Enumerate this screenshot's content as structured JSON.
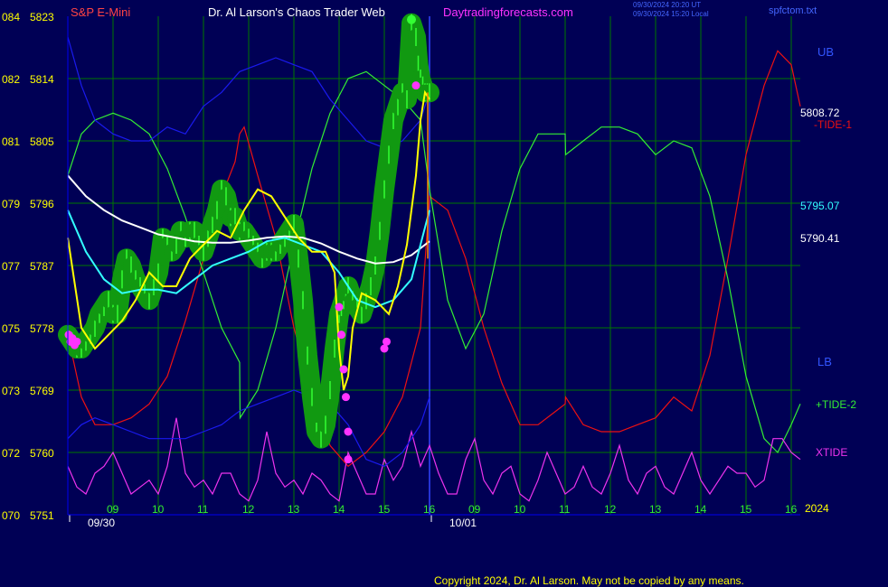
{
  "header": {
    "symbol": "S&P E-Mini",
    "author": "Dr. Al Larson's Chaos Trader Web",
    "site": "Daytradingforecasts.com",
    "stamp1": "09/30/2024 20:20 UT",
    "stamp2": "09/30/2024 15:20 Local",
    "file": "spfctom.txt"
  },
  "footer": {
    "copyright": "Copyright 2024, Dr. Al Larson. May not be copied by any means."
  },
  "chart_data": {
    "type": "line",
    "title": "S&P E-Mini",
    "ylim": [
      5751,
      5823
    ],
    "y_ticks": [
      {
        "outer": "084",
        "price": "5823",
        "v": 5823
      },
      {
        "outer": "082",
        "price": "5814",
        "v": 5814
      },
      {
        "outer": "081",
        "price": "5805",
        "v": 5805
      },
      {
        "outer": "079",
        "price": "5796",
        "v": 5796
      },
      {
        "outer": "077",
        "price": "5787",
        "v": 5787
      },
      {
        "outer": "075",
        "price": "5778",
        "v": 5778
      },
      {
        "outer": "073",
        "price": "5769",
        "v": 5769
      },
      {
        "outer": "072",
        "price": "5760",
        "v": 5760
      },
      {
        "outer": "070",
        "price": "5751",
        "v": 5751
      }
    ],
    "x_hour_ticks": [
      "09",
      "10",
      "11",
      "12",
      "13",
      "14",
      "15",
      "16",
      "09",
      "10",
      "11",
      "12",
      "13",
      "14",
      "15",
      "16"
    ],
    "x_hour_pos": [
      1.0,
      2.0,
      3.0,
      4.0,
      5.0,
      6.0,
      7.0,
      8.0,
      9.0,
      10.0,
      11.0,
      12.0,
      13.0,
      14.0,
      15.0,
      16.0
    ],
    "x_dates": [
      {
        "label": "09/30",
        "x": 0.8
      },
      {
        "label": "10/01",
        "x": 8.8
      }
    ],
    "x_corner": "2024",
    "xlim": [
      0,
      16.2
    ],
    "now_x": 8.0,
    "right_labels": {
      "ub": "UB",
      "lb": "LB",
      "value1": "5808.72",
      "value2": "5795.07",
      "value3": "5790.41",
      "tide1": "-TIDE-1",
      "tide2": "+TIDE-2",
      "xtide": "XTIDE"
    },
    "colors": {
      "background": "#000055",
      "grid": "#007700",
      "price_bar": "#33ff33",
      "glow": "#119911",
      "fast_ma": "#ffff00",
      "ma_cyan": "#33ffff",
      "ma_white": "#ffffff",
      "tide1": "#ee1111",
      "tide2": "#33ee33",
      "xtide": "#ee33ee",
      "bands": "#0000ee",
      "marker": "#ff33ff"
    },
    "series": [
      {
        "name": "-TIDE-1",
        "color": "#ee1111",
        "x": [
          0,
          0.3,
          0.6,
          1.0,
          1.4,
          1.8,
          2.2,
          2.6,
          3.0,
          3.4,
          3.7,
          3.8,
          3.9,
          4.2,
          4.6,
          5.0,
          5.4,
          5.8,
          6.2,
          6.6,
          7.0,
          7.4,
          7.8,
          8.0,
          8.4,
          8.8,
          9.2,
          9.6,
          10.0,
          10.4,
          10.8,
          11.0,
          11.01,
          11.4,
          11.8,
          12.2,
          12.6,
          13.0,
          13.4,
          13.8,
          14.2,
          14.6,
          15.0,
          15.4,
          15.7,
          16.0,
          16.2
        ],
        "y": [
          5777,
          5768,
          5764,
          5764,
          5765,
          5767,
          5771,
          5779,
          5788,
          5797,
          5802,
          5806,
          5807,
          5800,
          5791,
          5778,
          5769,
          5761,
          5758,
          5760,
          5763,
          5768,
          5778,
          5797,
          5795,
          5788,
          5778,
          5770,
          5764,
          5764,
          5766,
          5767,
          5768,
          5764,
          5763,
          5763,
          5764,
          5765,
          5768,
          5766,
          5774,
          5788,
          5803,
          5813,
          5818,
          5816,
          5810
        ]
      },
      {
        "name": "+TIDE-2",
        "color": "#33ee33",
        "x": [
          0,
          0.3,
          0.6,
          1.0,
          1.4,
          1.8,
          2.2,
          2.6,
          3.0,
          3.4,
          3.8,
          3.81,
          4.2,
          4.6,
          5.0,
          5.4,
          5.8,
          6.2,
          6.6,
          7.0,
          7.4,
          7.8,
          8.0,
          8.4,
          8.8,
          9.2,
          9.6,
          10.0,
          10.4,
          10.8,
          11.0,
          11.01,
          11.4,
          11.8,
          12.2,
          12.6,
          13.0,
          13.4,
          13.8,
          14.2,
          14.6,
          15.0,
          15.4,
          15.7,
          16.0,
          16.2
        ],
        "y": [
          5800,
          5806,
          5808,
          5809,
          5808,
          5806,
          5801,
          5794,
          5786,
          5778,
          5773,
          5765,
          5769,
          5778,
          5790,
          5801,
          5809,
          5814,
          5815,
          5813,
          5811,
          5808,
          5798,
          5782,
          5775,
          5780,
          5792,
          5801,
          5806,
          5806,
          5806,
          5803,
          5805,
          5807,
          5807,
          5806,
          5803,
          5805,
          5804,
          5797,
          5785,
          5771,
          5762,
          5760,
          5764,
          5767
        ]
      },
      {
        "name": "XTIDE",
        "color": "#ee33ee",
        "x": [
          0,
          0.2,
          0.4,
          0.6,
          0.8,
          1.0,
          1.2,
          1.4,
          1.6,
          1.8,
          2.0,
          2.2,
          2.4,
          2.6,
          2.8,
          3.0,
          3.2,
          3.4,
          3.6,
          3.8,
          4.0,
          4.2,
          4.4,
          4.6,
          4.8,
          5.0,
          5.2,
          5.4,
          5.6,
          5.8,
          6.0,
          6.2,
          6.4,
          6.6,
          6.8,
          7.0,
          7.2,
          7.4,
          7.6,
          7.8,
          8.0,
          8.2,
          8.4,
          8.6,
          8.8,
          9.0,
          9.2,
          9.4,
          9.6,
          9.8,
          10.0,
          10.2,
          10.4,
          10.6,
          10.8,
          11.0,
          11.2,
          11.4,
          11.6,
          11.8,
          12.0,
          12.2,
          12.4,
          12.6,
          12.8,
          13.0,
          13.2,
          13.4,
          13.6,
          13.8,
          14.0,
          14.2,
          14.4,
          14.6,
          14.8,
          15.0,
          15.2,
          15.4,
          15.6,
          15.8,
          16.0,
          16.2
        ],
        "y": [
          5758,
          5755,
          5754,
          5757,
          5758,
          5760,
          5757,
          5754,
          5755,
          5756,
          5754,
          5758,
          5765,
          5757,
          5755,
          5756,
          5754,
          5757,
          5757,
          5754,
          5753,
          5756,
          5763,
          5757,
          5755,
          5756,
          5754,
          5757,
          5756,
          5754,
          5753,
          5760,
          5757,
          5754,
          5754,
          5759,
          5756,
          5758,
          5763,
          5758,
          5761,
          5757,
          5754,
          5754,
          5759,
          5762,
          5756,
          5754,
          5757,
          5758,
          5754,
          5753,
          5756,
          5760,
          5757,
          5754,
          5755,
          5758,
          5755,
          5754,
          5757,
          5761,
          5756,
          5754,
          5757,
          5758,
          5755,
          5754,
          5757,
          5760,
          5756,
          5754,
          5756,
          5758,
          5757,
          5757,
          5755,
          5756,
          5762,
          5762,
          5760,
          5759
        ]
      },
      {
        "name": "upper band",
        "color": "#1a1aee",
        "x": [
          0,
          0.3,
          0.6,
          1.0,
          1.4,
          1.8,
          2.2,
          2.6,
          3.0,
          3.4,
          3.8,
          4.2,
          4.6,
          5.0,
          5.4,
          5.8,
          6.2,
          6.6,
          7.0,
          7.4,
          7.8,
          8.0
        ],
        "y": [
          5820,
          5813,
          5808,
          5806,
          5805,
          5805,
          5807,
          5806,
          5810,
          5812,
          5815,
          5816,
          5817,
          5816,
          5815,
          5811,
          5808,
          5805,
          5804,
          5805,
          5808,
          5812
        ]
      },
      {
        "name": "lower band",
        "color": "#1a1aee",
        "x": [
          0,
          0.3,
          0.6,
          1.0,
          1.4,
          1.8,
          2.2,
          2.6,
          3.0,
          3.4,
          3.8,
          4.2,
          4.6,
          5.0,
          5.4,
          5.8,
          6.2,
          6.6,
          7.0,
          7.4,
          7.8,
          8.0
        ],
        "y": [
          5762,
          5764,
          5765,
          5764,
          5763,
          5762,
          5762,
          5762,
          5763,
          5764,
          5766,
          5767,
          5768,
          5769,
          5768,
          5767,
          5764,
          5759,
          5758,
          5760,
          5764,
          5768
        ]
      },
      {
        "name": "white MA",
        "color": "#ffffff",
        "x": [
          0,
          0.4,
          0.8,
          1.2,
          1.6,
          2.0,
          2.4,
          2.8,
          3.2,
          3.6,
          4.0,
          4.4,
          4.8,
          5.2,
          5.6,
          6.0,
          6.4,
          6.8,
          7.2,
          7.6,
          8.0
        ],
        "y": [
          5800,
          5797,
          5795,
          5793.5,
          5792.5,
          5791.5,
          5791,
          5790.5,
          5790.3,
          5790.3,
          5790.6,
          5791,
          5791.2,
          5791,
          5790.2,
          5789,
          5788,
          5787.3,
          5787.5,
          5788.5,
          5790.5
        ]
      },
      {
        "name": "cyan MA",
        "color": "#33ffff",
        "x": [
          0,
          0.4,
          0.8,
          1.2,
          1.6,
          2.0,
          2.4,
          2.8,
          3.2,
          3.6,
          4.0,
          4.4,
          4.8,
          5.2,
          5.6,
          6.0,
          6.4,
          6.8,
          7.2,
          7.6,
          8.0
        ],
        "y": [
          5795,
          5789,
          5785,
          5783,
          5783.5,
          5783.5,
          5783,
          5785,
          5787,
          5788,
          5789,
          5790.5,
          5791,
          5790,
          5789,
          5786,
          5782,
          5781,
          5782,
          5785,
          5795
        ]
      },
      {
        "name": "yellow MA",
        "color": "#ffff00",
        "x": [
          0,
          0.3,
          0.6,
          0.9,
          1.2,
          1.5,
          1.8,
          2.1,
          2.4,
          2.7,
          3.0,
          3.3,
          3.6,
          3.9,
          4.2,
          4.5,
          4.8,
          5.1,
          5.4,
          5.7,
          5.9,
          6.0,
          6.1,
          6.2,
          6.3,
          6.5,
          6.8,
          7.1,
          7.3,
          7.5,
          7.7,
          7.8,
          7.9,
          8.0
        ],
        "y": [
          5791,
          5778,
          5775,
          5777,
          5779,
          5782,
          5786,
          5784,
          5784,
          5788,
          5790,
          5792,
          5791,
          5795,
          5798,
          5797,
          5794,
          5791,
          5789,
          5789,
          5786,
          5775,
          5769,
          5771,
          5778,
          5783,
          5782,
          5780,
          5784,
          5790,
          5800,
          5808,
          5812,
          5811
        ]
      }
    ],
    "price_points": {
      "x": [
        0,
        0.1,
        0.2,
        0.3,
        0.4,
        0.5,
        0.6,
        0.7,
        0.8,
        0.9,
        1.0,
        1.1,
        1.2,
        1.3,
        1.4,
        1.5,
        1.6,
        1.7,
        1.8,
        1.9,
        2.0,
        2.1,
        2.2,
        2.3,
        2.4,
        2.5,
        2.6,
        2.7,
        2.8,
        2.9,
        3.0,
        3.1,
        3.2,
        3.3,
        3.4,
        3.5,
        3.6,
        3.7,
        3.8,
        3.9,
        4.0,
        4.1,
        4.2,
        4.3,
        4.4,
        4.5,
        4.6,
        4.7,
        4.8,
        4.9,
        5.0,
        5.1,
        5.2,
        5.3,
        5.4,
        5.5,
        5.6,
        5.7,
        5.8,
        5.9,
        6.0,
        6.05,
        6.1,
        6.15,
        6.2,
        6.3,
        6.4,
        6.5,
        6.6,
        6.7,
        6.8,
        6.9,
        7.0,
        7.1,
        7.2,
        7.3,
        7.4,
        7.5,
        7.6,
        7.7,
        7.75,
        7.8,
        7.85,
        7.9,
        7.95,
        8.0
      ],
      "y": [
        5777,
        5776,
        5775,
        5775,
        5776,
        5777,
        5778,
        5780,
        5781,
        5782,
        5780,
        5780,
        5785,
        5788,
        5787,
        5785,
        5784,
        5783,
        5782,
        5784,
        5786,
        5791,
        5790,
        5789,
        5790,
        5792,
        5791,
        5792,
        5792,
        5790,
        5789,
        5791,
        5793,
        5795,
        5798,
        5797,
        5794,
        5794,
        5792,
        5792,
        5791,
        5790,
        5789,
        5788,
        5789,
        5789,
        5789,
        5790,
        5791,
        5792,
        5793,
        5788,
        5782,
        5774,
        5768,
        5763,
        5762,
        5764,
        5769,
        5775,
        5780,
        5781,
        5782,
        5783,
        5784,
        5782,
        5781,
        5780,
        5782,
        5784,
        5787,
        5792,
        5798,
        5803,
        5808,
        5810,
        5812,
        5811,
        5822,
        5820,
        5816,
        5814,
        5813,
        5812,
        5812,
        5812
      ]
    },
    "markers": {
      "x": [
        0.02,
        0.06,
        0.1,
        0.15,
        0.2,
        6.0,
        6.05,
        6.1,
        6.15,
        6.2,
        6.2,
        7.0,
        7.05,
        7.7
      ],
      "y": [
        5777,
        5776,
        5776.5,
        5775.5,
        5776,
        5781,
        5777,
        5772,
        5768,
        5763,
        5759,
        5775,
        5776,
        5813
      ]
    }
  }
}
